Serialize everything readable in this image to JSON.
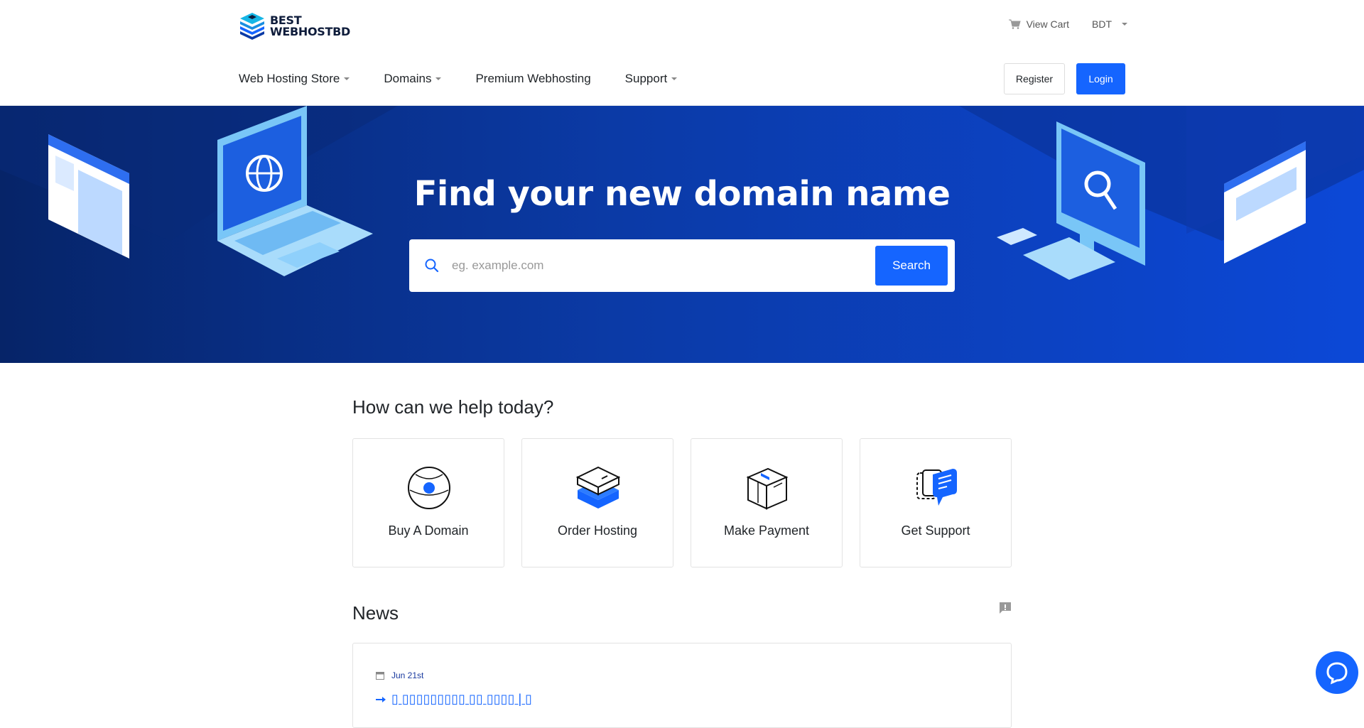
{
  "brand": {
    "line1": "BEST",
    "line2": "WEBHOSTBD"
  },
  "topbar": {
    "view_cart": "View Cart",
    "currency": "BDT"
  },
  "nav": {
    "items": [
      {
        "label": "Web Hosting Store",
        "dropdown": true
      },
      {
        "label": "Domains",
        "dropdown": true
      },
      {
        "label": "Premium Webhosting",
        "dropdown": false
      },
      {
        "label": "Support",
        "dropdown": true
      }
    ],
    "register": "Register",
    "login": "Login"
  },
  "hero": {
    "title": "Find your new domain name",
    "search_placeholder": "eg. example.com",
    "search_button": "Search"
  },
  "help": {
    "title": "How can we help today?",
    "cards": [
      {
        "label": "Buy A Domain",
        "icon": "globe-icon"
      },
      {
        "label": "Order Hosting",
        "icon": "server-icon"
      },
      {
        "label": "Make Payment",
        "icon": "payment-box-icon"
      },
      {
        "label": "Get Support",
        "icon": "support-chat-icon"
      }
    ]
  },
  "news": {
    "title": "News",
    "items": [
      {
        "date": "Jun 21st",
        "headline": "▯ ▯▯▯▯▯▯▯▯▯ ▯▯ ▯▯▯▯ | ▯"
      }
    ]
  },
  "colors": {
    "primary": "#1565ff",
    "hero_dark": "#062468",
    "hero_light": "#0c48d7"
  }
}
